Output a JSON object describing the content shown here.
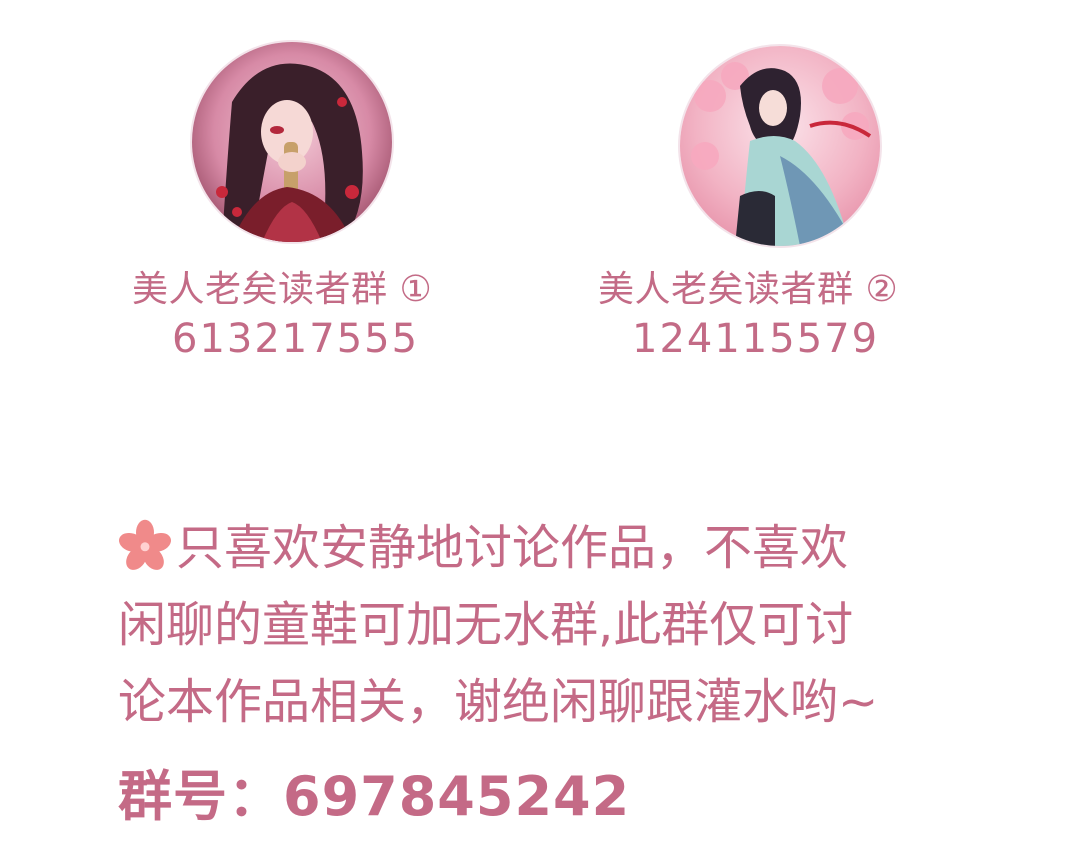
{
  "colors": {
    "accent": "#c46a86",
    "background": "#ffffff",
    "sakura": "#f08a8a"
  },
  "groups": [
    {
      "avatar_icon": "anime-girl-dark-hair-avatar",
      "name": "美人老矣读者群 ①",
      "number": "613217555"
    },
    {
      "avatar_icon": "anime-girl-cherry-blossom-avatar",
      "name": "美人老矣读者群 ②",
      "number": "124115579"
    }
  ],
  "notice": {
    "icon": "sakura-icon",
    "lines": [
      "只喜欢安静地讨论作品，不喜欢",
      "闲聊的童鞋可加无水群,此群仅可讨",
      "论本作品相关，谢绝闲聊跟灌水哟~"
    ]
  },
  "footer": {
    "text": "群号：697845242"
  }
}
